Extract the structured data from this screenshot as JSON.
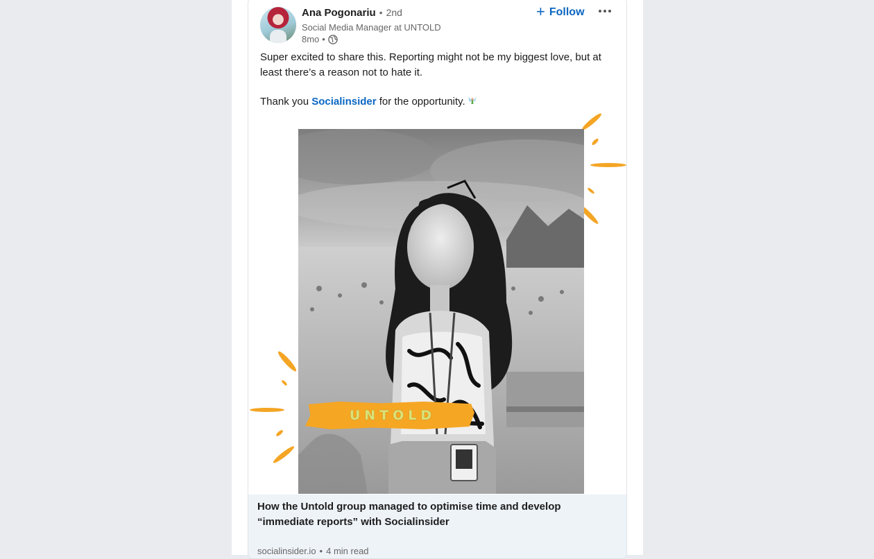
{
  "post": {
    "author": {
      "name": "Ana Pogonariu",
      "degree": "2nd",
      "headline": "Social Media Manager at UNTOLD",
      "time": "8mo",
      "separator": "•"
    },
    "actions": {
      "follow_icon": "+",
      "follow_label": "Follow",
      "more_icon": "more-horizontal-icon"
    },
    "text": {
      "line1": "Super excited to share this. Reporting might not be my biggest love, but at least there’s a reason not to hate it.",
      "line2_before": "Thank you ",
      "mention": "Socialinsider",
      "line2_after": " for the opportunity."
    },
    "media": {
      "banner_text": "UNTOLD"
    },
    "link_preview": {
      "title": "How the Untold group managed to optimise time and develop “immediate reports” with Socialinsider",
      "domain": "socialinsider.io",
      "separator": "•",
      "read_time": "4 min read"
    }
  },
  "colors": {
    "accent": "#0a66c2",
    "brush": "#f4a524",
    "page_bg": "#e9ebef",
    "preview_bg": "#eef3f8"
  }
}
